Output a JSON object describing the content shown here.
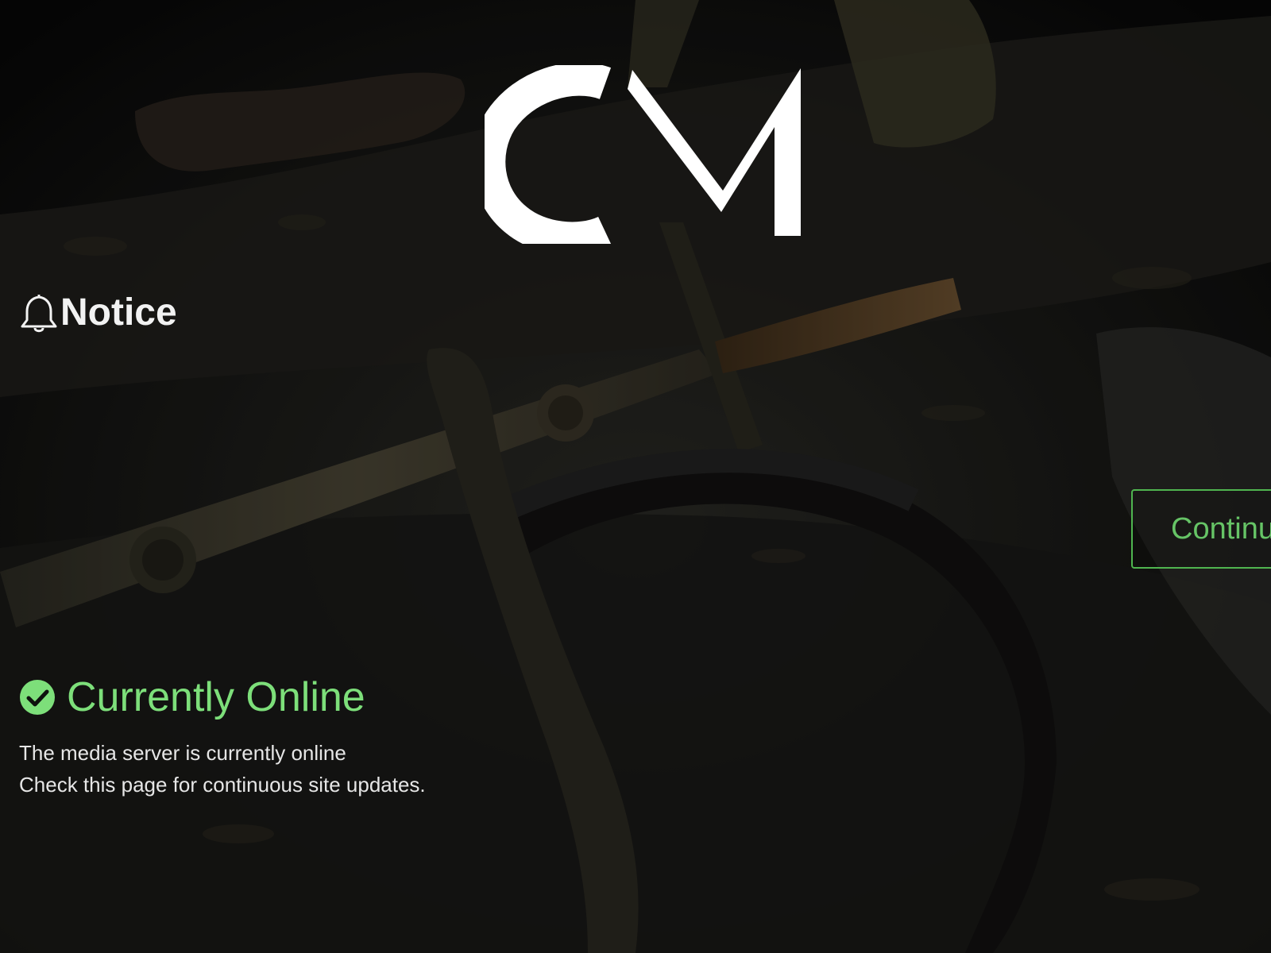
{
  "logo": {
    "text": "CM",
    "color": "#ffffff"
  },
  "notice": {
    "icon": "bell-icon",
    "title": "Notice"
  },
  "continue_button": {
    "label": "Continue",
    "color": "#66c466"
  },
  "status": {
    "icon": "check-circle-icon",
    "label": "Currently Online",
    "color": "#7ddf7a"
  },
  "description": {
    "line1": "The media server is currently online",
    "line2": "Check this page for continuous site updates."
  }
}
